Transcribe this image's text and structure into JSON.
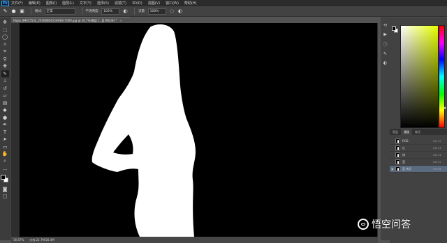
{
  "app": {
    "logo": "Ps"
  },
  "menu": [
    "文件(F)",
    "编辑(E)",
    "图像(I)",
    "图层(L)",
    "文字(Y)",
    "选择(S)",
    "滤镜(T)",
    "3D(D)",
    "视图(V)",
    "窗口(W)",
    "帮助(H)"
  ],
  "options": {
    "mode_label": "模式:",
    "mode_value": "正常",
    "opacity_label": "不透明度:",
    "opacity_value": "100%",
    "flow_label": "流量:",
    "flow_value": "100%"
  },
  "document": {
    "tab_title": "fdgas_89615532_2016080415493617000.jpg @ 16.7%(图层 1, 蓝 拷贝/8) *",
    "close_glyph": "×"
  },
  "status": {
    "zoom": "16.67%",
    "doc_size": "文档:22.7M/26.4M"
  },
  "panels": {
    "color_tab": "颜色",
    "channel_tabs": [
      "图层",
      "通道",
      "路径"
    ],
    "channels": [
      {
        "name": "RGB",
        "shortcut": "Ctrl+2"
      },
      {
        "name": "红",
        "shortcut": "Ctrl+3"
      },
      {
        "name": "绿",
        "shortcut": "Ctrl+4"
      },
      {
        "name": "蓝",
        "shortcut": "Ctrl+5"
      },
      {
        "name": "蓝 拷贝",
        "shortcut": "Ctrl+6"
      }
    ]
  },
  "watermark": {
    "text": "悟空问答"
  },
  "colors": {
    "foreground": "#000000",
    "background": "#ffffff"
  }
}
